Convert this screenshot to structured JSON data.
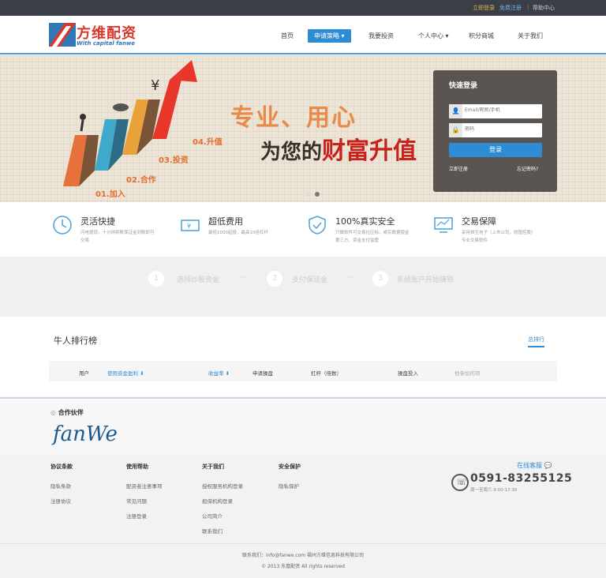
{
  "topbar": {
    "login": "立即登录",
    "register": "免费注册",
    "help": "帮助中心"
  },
  "logo": {
    "title": "方维配资",
    "subtitle": "With capital fanwe"
  },
  "nav": [
    "首页",
    "申请策略 ▾",
    "我要投资",
    "个人中心 ▾",
    "积分商城",
    "关于我们"
  ],
  "banner": {
    "slogan_line1": "专业、用心",
    "slogan_line2_prefix": "为您的",
    "slogan_line2_highlight": "财富升值",
    "steps": [
      "01.加入",
      "02.合作",
      "03.投资",
      "04.升值"
    ]
  },
  "login": {
    "title": "快速登录",
    "username_placeholder": "Email/昵称/手机",
    "password_placeholder": "密码",
    "button": "登录",
    "register_link": "立即注册",
    "forgot_link": "忘记密码?"
  },
  "features": [
    {
      "title": "灵活快捷",
      "desc": "闪电提现，十分钟到账保证金到账即可交易",
      "icon": "clock-icon"
    },
    {
      "title": "超低费用",
      "desc": "最低1000起投，最高10倍杠杆",
      "icon": "money-icon"
    },
    {
      "title": "100%真实安全",
      "desc": "只做软件可交易社区标，或实数据使金第三方，资金支付监管",
      "icon": "shield-check-icon"
    },
    {
      "title": "交易保障",
      "desc": "采用恒生电子（上市公司，财国控股）专业交易软件",
      "icon": "monitor-icon"
    }
  ],
  "steps": [
    {
      "num": "1",
      "label": "选择炒股资金"
    },
    {
      "num": "2",
      "label": "支付保证金"
    },
    {
      "num": "3",
      "label": "系统账户开始赚钱"
    }
  ],
  "ranking": {
    "title": "牛人排行榜",
    "all_link": "总排行",
    "columns": [
      "用户",
      "使用资金盈利 ⬇",
      "收益率 ⬇",
      "申请操盘",
      "杠杆（倍数）",
      "操盘投入",
      "他参加的项"
    ]
  },
  "partners": {
    "title": "合作伙伴",
    "logo_text": "fanWe"
  },
  "footer": {
    "columns": [
      {
        "title": "协议条款",
        "links": [
          "隐私条款",
          "注册协议"
        ]
      },
      {
        "title": "使用帮助",
        "links": [
          "配资者注意事项",
          "常见问题",
          "注册登录"
        ]
      },
      {
        "title": "关于我们",
        "links": [
          "授权服务机构登录",
          "担保机构登录",
          "公司简介",
          "联系我们"
        ]
      },
      {
        "title": "安全保护",
        "links": [
          "隐私保护"
        ]
      }
    ],
    "service": "在线客服",
    "phone": "0591-83255125",
    "hours": "周一至周六 9:00-17:30",
    "contact": "联系我们：info@fanwe.com    福州方维信息科技有限公司",
    "copyright": "© 2013 东凰配资 All rights reserved"
  },
  "colors": {
    "accent": "#2e8cd5",
    "brand_red": "#d9372b",
    "topbar": "#3a3f47"
  }
}
